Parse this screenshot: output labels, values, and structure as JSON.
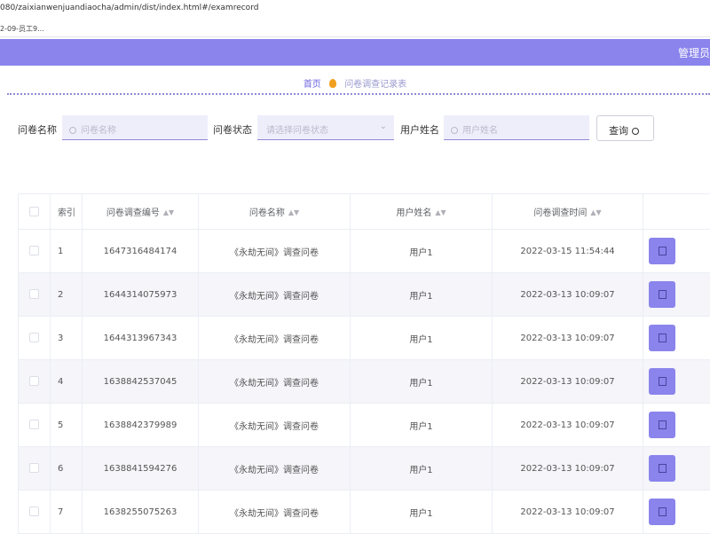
{
  "browser": {
    "url": "080/zaixianwenjuandiaocha/admin/dist/index.html#/examrecord",
    "bookmark": "2-09-员工9..."
  },
  "header": {
    "title": "管理员"
  },
  "breadcrumb": {
    "home": "首页",
    "current": "问卷调查记录表"
  },
  "filters": {
    "name_label": "问卷名称",
    "name_placeholder": "问卷名称",
    "status_label": "问卷状态",
    "status_placeholder": "请选择问卷状态",
    "user_label": "用户姓名",
    "user_placeholder": "用户姓名",
    "query_label": "查询"
  },
  "table": {
    "columns": [
      "索引",
      "问卷调查编号",
      "问卷名称",
      "用户姓名",
      "问卷调查时间"
    ],
    "rows": [
      {
        "index": "1",
        "code": "1647316484174",
        "name": "《永劫无间》调查问卷",
        "user": "用户1",
        "time": "2022-03-15 11:54:44"
      },
      {
        "index": "2",
        "code": "1644314075973",
        "name": "《永劫无间》调查问卷",
        "user": "用户1",
        "time": "2022-03-13 10:09:07"
      },
      {
        "index": "3",
        "code": "1644313967343",
        "name": "《永劫无间》调查问卷",
        "user": "用户1",
        "time": "2022-03-13 10:09:07"
      },
      {
        "index": "4",
        "code": "1638842537045",
        "name": "《永劫无间》调查问卷",
        "user": "用户1",
        "time": "2022-03-13 10:09:07"
      },
      {
        "index": "5",
        "code": "1638842379989",
        "name": "《永劫无间》调查问卷",
        "user": "用户1",
        "time": "2022-03-13 10:09:07"
      },
      {
        "index": "6",
        "code": "1638841594276",
        "name": "《永劫无间》调查问卷",
        "user": "用户1",
        "time": "2022-03-13 10:09:07"
      },
      {
        "index": "7",
        "code": "1638255075263",
        "name": "《永劫无间》调查问卷",
        "user": "用户1",
        "time": "2022-03-13 10:09:07"
      }
    ]
  },
  "colors": {
    "accent": "#8a84ec",
    "link": "#6a64e0"
  }
}
